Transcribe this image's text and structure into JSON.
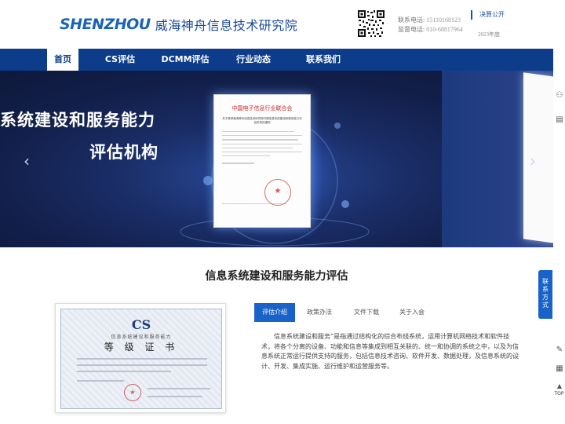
{
  "header": {
    "logo_en": "SHENZHOU",
    "logo_cn": "威海神舟信息技术研究院",
    "contact": {
      "phone_label": "联系电话:",
      "phone_value": "15110168123",
      "supervise_label": "监督电话:",
      "supervise_value": "010-68817964"
    },
    "notice": {
      "title": "决算公开",
      "year": "2023年度"
    }
  },
  "nav": {
    "items": [
      {
        "label": "首页",
        "active": true
      },
      {
        "label": "CS评估",
        "active": false
      },
      {
        "label": "DCMM评估",
        "active": false
      },
      {
        "label": "行业动态",
        "active": false
      },
      {
        "label": "联系我们",
        "active": false
      }
    ]
  },
  "banner": {
    "line1": "系统建设和服务能力",
    "line2": "评估机构",
    "document": {
      "title": "中国电子信息行业联合会",
      "subtitle": "关于推荐威海神舟信息技术研究院开展信息系统建设和服务能力评估机构的通知"
    }
  },
  "sidebar": {
    "contact_label": "联系方式",
    "top_label": "TOP"
  },
  "main": {
    "section_title": "信息系统建设和服务能力评估",
    "certificate": {
      "brand": "CS",
      "org": "信息系统建设和服务能力",
      "name": "等 级 证 书"
    },
    "tabs": [
      {
        "label": "评估介绍",
        "active": true
      },
      {
        "label": "政策办法",
        "active": false
      },
      {
        "label": "文件下载",
        "active": false
      },
      {
        "label": "关于入会",
        "active": false
      }
    ],
    "tab_content": "信息系统建设和服务”是指通过结构化的综合布线系统，运用计算机网络技术和软件技术，将各个分离的设备、功能和信息等集成到相互关联的、统一和协调的系统之中，以及为信息系统正常运行提供支持的服务，包括信息技术咨询、软件开发、数据处理，及信息系统的设计、开发、集成实施、运行维护和运营服务等。"
  }
}
